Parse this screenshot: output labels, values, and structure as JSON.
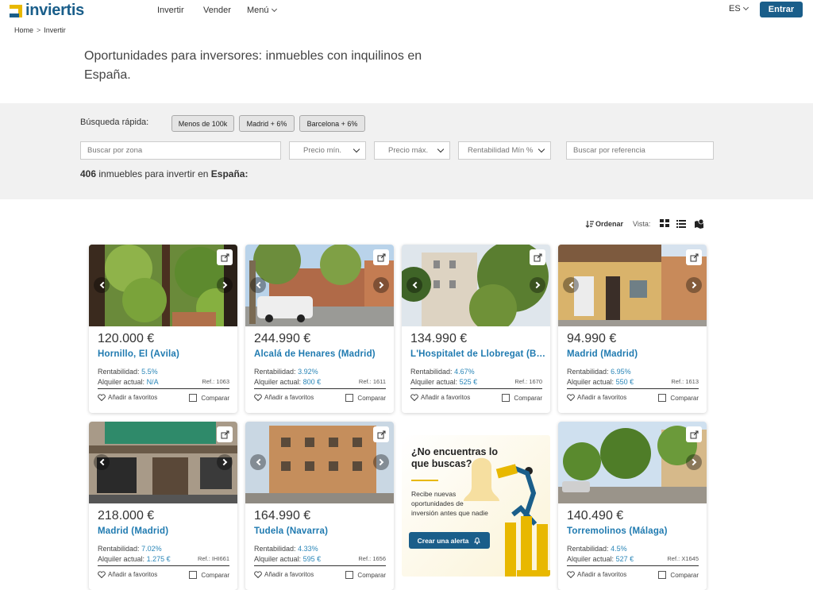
{
  "brand": {
    "name": "inviertis",
    "colors": {
      "primary": "#1a5e8a",
      "accent": "#e8b800",
      "link": "#1f7ab0"
    }
  },
  "nav": {
    "invertir": "Invertir",
    "vender": "Vender",
    "menu": "Menú",
    "lang": "ES",
    "login": "Entrar"
  },
  "breadcrumb": {
    "home": "Home",
    "sep": ">",
    "current": "Invertir"
  },
  "hero": {
    "title": "Oportunidades para inversores: inmuebles con inquilinos en España."
  },
  "search": {
    "quick_label": "Búsqueda rápida:",
    "chips": [
      "Menos de 100k",
      "Madrid + 6%",
      "Barcelona + 6%"
    ],
    "zone_placeholder": "Buscar por zona",
    "price_min": "Precio mín.",
    "price_max": "Precio máx.",
    "yield_min": "Rentabilidad Mín %",
    "ref_placeholder": "Buscar por referencia"
  },
  "results": {
    "count": "406",
    "text": "inmuebles para invertir en",
    "country": "España:"
  },
  "toolbar": {
    "sort": "Ordenar",
    "vista": "Vista:"
  },
  "labels": {
    "rent": "Rentabilidad:",
    "alq": "Alquiler actual:",
    "ref": "Ref.:",
    "fav": "Añadir a favoritos",
    "compare": "Comparar"
  },
  "listings": [
    {
      "price": "120.000 €",
      "city": "Hornillo, El (Ávila)",
      "rent": "5.5%",
      "alq": "N/A",
      "ref": "1063"
    },
    {
      "price": "244.990 €",
      "city": "Alcalá de Henares (Madrid)",
      "rent": "3.92%",
      "alq": "800 €",
      "ref": "1611"
    },
    {
      "price": "134.990 €",
      "city": "L'Hospitalet de Llobregat (Barcelona)",
      "rent": "4.67%",
      "alq": "525 €",
      "ref": "1670"
    },
    {
      "price": "94.990 €",
      "city": "Madrid (Madrid)",
      "rent": "6.95%",
      "alq": "550 €",
      "ref": "1613"
    },
    {
      "price": "218.000 €",
      "city": "Madrid (Madrid)",
      "rent": "7.02%",
      "alq": "1.275 €",
      "ref": "IHI661"
    },
    {
      "price": "164.990 €",
      "city": "Tudela (Navarra)",
      "rent": "4.33%",
      "alq": "595 €",
      "ref": "1656"
    },
    {
      "price": "140.490 €",
      "city": "Torremolinos (Málaga)",
      "rent": "4.5%",
      "alq": "527 €",
      "ref": "X1645"
    }
  ],
  "promo": {
    "title": "¿No encuentras lo que buscas?",
    "text": "Recibe nuevas oportunidades de inversión antes que nadie",
    "button": "Crear una alerta"
  }
}
